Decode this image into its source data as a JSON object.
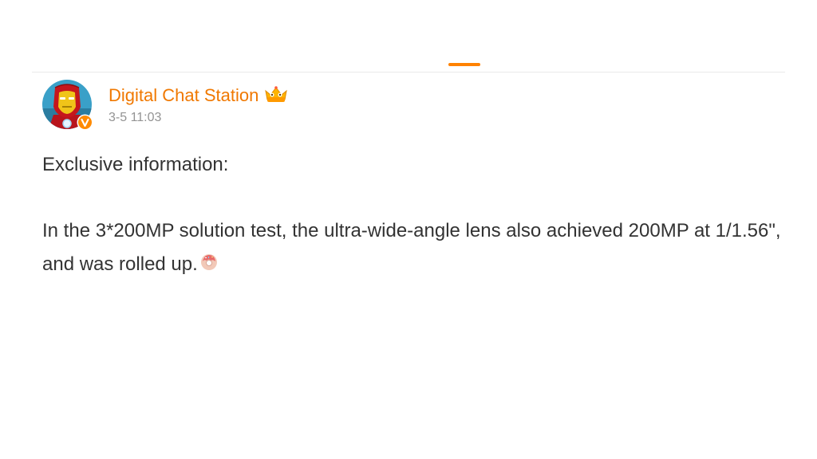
{
  "tab": {
    "active_color": "#ff8200"
  },
  "post": {
    "author": {
      "name": "Digital Chat Station",
      "avatar_icon": "iron-man-avatar",
      "verified_icon": "verified-v-badge-icon",
      "badge_icon": "crown-fan-badge-icon",
      "name_color": "#f07800"
    },
    "timestamp": "3-5 11:03",
    "paragraphs": [
      "Exclusive information:",
      "In the 3*200MP solution test, the ultra-wide-angle lens also achieved 200MP at 1/1.56\", and was rolled up."
    ],
    "trailing_emoji": "donut-emoji-icon"
  }
}
